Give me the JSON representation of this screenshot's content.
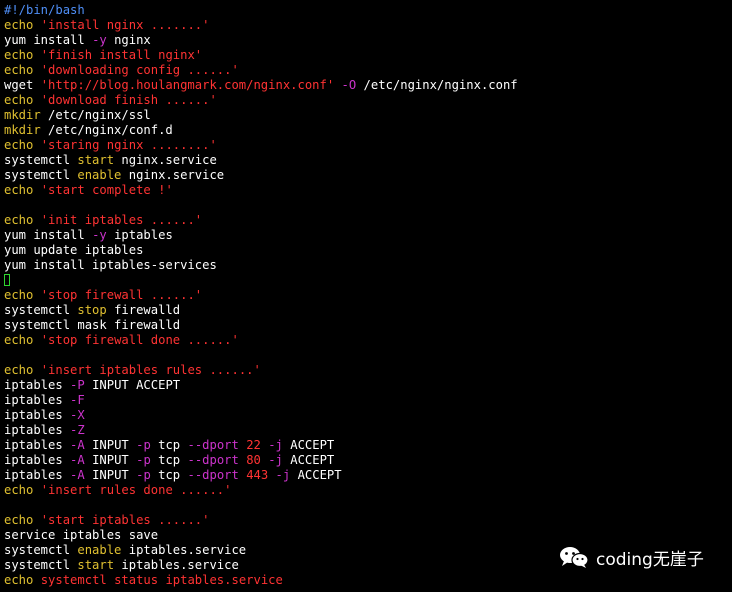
{
  "colors": {
    "shebang": "#4f8ff7",
    "keyword": "#e0c030",
    "string": "#ff3333",
    "option": "#cc33cc",
    "plain": "#ffffff",
    "cursor": "#2fd52f",
    "background": "#000000"
  },
  "lines": [
    [
      {
        "t": "#!/bin/bash",
        "c": "shebang"
      }
    ],
    [
      {
        "t": "echo",
        "c": "keyword"
      },
      {
        "t": " ",
        "c": "plain"
      },
      {
        "t": "'install nginx .......'",
        "c": "string"
      }
    ],
    [
      {
        "t": "yum install ",
        "c": "plain"
      },
      {
        "t": "-y",
        "c": "option"
      },
      {
        "t": " nginx",
        "c": "plain"
      }
    ],
    [
      {
        "t": "echo",
        "c": "keyword"
      },
      {
        "t": " ",
        "c": "plain"
      },
      {
        "t": "'finish install nginx'",
        "c": "string"
      }
    ],
    [
      {
        "t": "echo",
        "c": "keyword"
      },
      {
        "t": " ",
        "c": "plain"
      },
      {
        "t": "'downloading config ......'",
        "c": "string"
      }
    ],
    [
      {
        "t": "wget ",
        "c": "plain"
      },
      {
        "t": "'http://blog.houlangmark.com/nginx.conf'",
        "c": "string"
      },
      {
        "t": " ",
        "c": "plain"
      },
      {
        "t": "-O",
        "c": "option"
      },
      {
        "t": " /etc/nginx/nginx.conf",
        "c": "plain"
      }
    ],
    [
      {
        "t": "echo",
        "c": "keyword"
      },
      {
        "t": " ",
        "c": "plain"
      },
      {
        "t": "'download finish ......'",
        "c": "string"
      }
    ],
    [
      {
        "t": "mkdir",
        "c": "keyword"
      },
      {
        "t": " /etc/nginx/ssl",
        "c": "plain"
      }
    ],
    [
      {
        "t": "mkdir",
        "c": "keyword"
      },
      {
        "t": " /etc/nginx/conf.d",
        "c": "plain"
      }
    ],
    [
      {
        "t": "echo",
        "c": "keyword"
      },
      {
        "t": " ",
        "c": "plain"
      },
      {
        "t": "'staring nginx ........'",
        "c": "string"
      }
    ],
    [
      {
        "t": "systemctl ",
        "c": "plain"
      },
      {
        "t": "start",
        "c": "keyword"
      },
      {
        "t": " nginx.service",
        "c": "plain"
      }
    ],
    [
      {
        "t": "systemctl ",
        "c": "plain"
      },
      {
        "t": "enable",
        "c": "keyword"
      },
      {
        "t": " nginx.service",
        "c": "plain"
      }
    ],
    [
      {
        "t": "echo",
        "c": "keyword"
      },
      {
        "t": " ",
        "c": "plain"
      },
      {
        "t": "'start complete !'",
        "c": "string"
      }
    ],
    [],
    [
      {
        "t": "echo",
        "c": "keyword"
      },
      {
        "t": " ",
        "c": "plain"
      },
      {
        "t": "'init iptables ......'",
        "c": "string"
      }
    ],
    [
      {
        "t": "yum install ",
        "c": "plain"
      },
      {
        "t": "-y",
        "c": "option"
      },
      {
        "t": " iptables",
        "c": "plain"
      }
    ],
    [
      {
        "t": "yum update iptables",
        "c": "plain"
      }
    ],
    [
      {
        "t": "yum install iptables-services",
        "c": "plain"
      }
    ],
    [
      {
        "t": "",
        "c": "cursor"
      }
    ],
    [
      {
        "t": "echo",
        "c": "keyword"
      },
      {
        "t": " ",
        "c": "plain"
      },
      {
        "t": "'stop firewall ......'",
        "c": "string"
      }
    ],
    [
      {
        "t": "systemctl ",
        "c": "plain"
      },
      {
        "t": "stop",
        "c": "keyword"
      },
      {
        "t": " firewalld",
        "c": "plain"
      }
    ],
    [
      {
        "t": "systemctl mask firewalld",
        "c": "plain"
      }
    ],
    [
      {
        "t": "echo",
        "c": "keyword"
      },
      {
        "t": " ",
        "c": "plain"
      },
      {
        "t": "'stop firewall done ......'",
        "c": "string"
      }
    ],
    [],
    [
      {
        "t": "echo",
        "c": "keyword"
      },
      {
        "t": " ",
        "c": "plain"
      },
      {
        "t": "'insert iptables rules ......'",
        "c": "string"
      }
    ],
    [
      {
        "t": "iptables ",
        "c": "plain"
      },
      {
        "t": "-P",
        "c": "option"
      },
      {
        "t": " INPUT ACCEPT",
        "c": "plain"
      }
    ],
    [
      {
        "t": "iptables ",
        "c": "plain"
      },
      {
        "t": "-F",
        "c": "option"
      }
    ],
    [
      {
        "t": "iptables ",
        "c": "plain"
      },
      {
        "t": "-X",
        "c": "option"
      }
    ],
    [
      {
        "t": "iptables ",
        "c": "plain"
      },
      {
        "t": "-Z",
        "c": "option"
      }
    ],
    [
      {
        "t": "iptables ",
        "c": "plain"
      },
      {
        "t": "-A",
        "c": "option"
      },
      {
        "t": " INPUT ",
        "c": "plain"
      },
      {
        "t": "-p",
        "c": "option"
      },
      {
        "t": " tcp ",
        "c": "plain"
      },
      {
        "t": "--dport",
        "c": "option"
      },
      {
        "t": " 22 ",
        "c": "string"
      },
      {
        "t": "-j",
        "c": "option"
      },
      {
        "t": " ACCEPT",
        "c": "plain"
      }
    ],
    [
      {
        "t": "iptables ",
        "c": "plain"
      },
      {
        "t": "-A",
        "c": "option"
      },
      {
        "t": " INPUT ",
        "c": "plain"
      },
      {
        "t": "-p",
        "c": "option"
      },
      {
        "t": " tcp ",
        "c": "plain"
      },
      {
        "t": "--dport",
        "c": "option"
      },
      {
        "t": " 80 ",
        "c": "string"
      },
      {
        "t": "-j",
        "c": "option"
      },
      {
        "t": " ACCEPT",
        "c": "plain"
      }
    ],
    [
      {
        "t": "iptables ",
        "c": "plain"
      },
      {
        "t": "-A",
        "c": "option"
      },
      {
        "t": " INPUT ",
        "c": "plain"
      },
      {
        "t": "-p",
        "c": "option"
      },
      {
        "t": " tcp ",
        "c": "plain"
      },
      {
        "t": "--dport",
        "c": "option"
      },
      {
        "t": " 443 ",
        "c": "string"
      },
      {
        "t": "-j",
        "c": "option"
      },
      {
        "t": " ACCEPT",
        "c": "plain"
      }
    ],
    [
      {
        "t": "echo",
        "c": "keyword"
      },
      {
        "t": " ",
        "c": "plain"
      },
      {
        "t": "'insert rules done ......'",
        "c": "string"
      }
    ],
    [],
    [
      {
        "t": "echo",
        "c": "keyword"
      },
      {
        "t": " ",
        "c": "plain"
      },
      {
        "t": "'start iptables ......'",
        "c": "string"
      }
    ],
    [
      {
        "t": "service iptables save",
        "c": "plain"
      }
    ],
    [
      {
        "t": "systemctl ",
        "c": "plain"
      },
      {
        "t": "enable",
        "c": "keyword"
      },
      {
        "t": " iptables.service",
        "c": "plain"
      }
    ],
    [
      {
        "t": "systemctl ",
        "c": "plain"
      },
      {
        "t": "start",
        "c": "keyword"
      },
      {
        "t": " iptables.service",
        "c": "plain"
      }
    ],
    [
      {
        "t": "echo",
        "c": "keyword"
      },
      {
        "t": " ",
        "c": "plain"
      },
      {
        "t": "systemctl status iptables.service",
        "c": "string"
      }
    ]
  ],
  "watermark": {
    "icon": "wechat-icon",
    "text": "coding无崖子"
  }
}
